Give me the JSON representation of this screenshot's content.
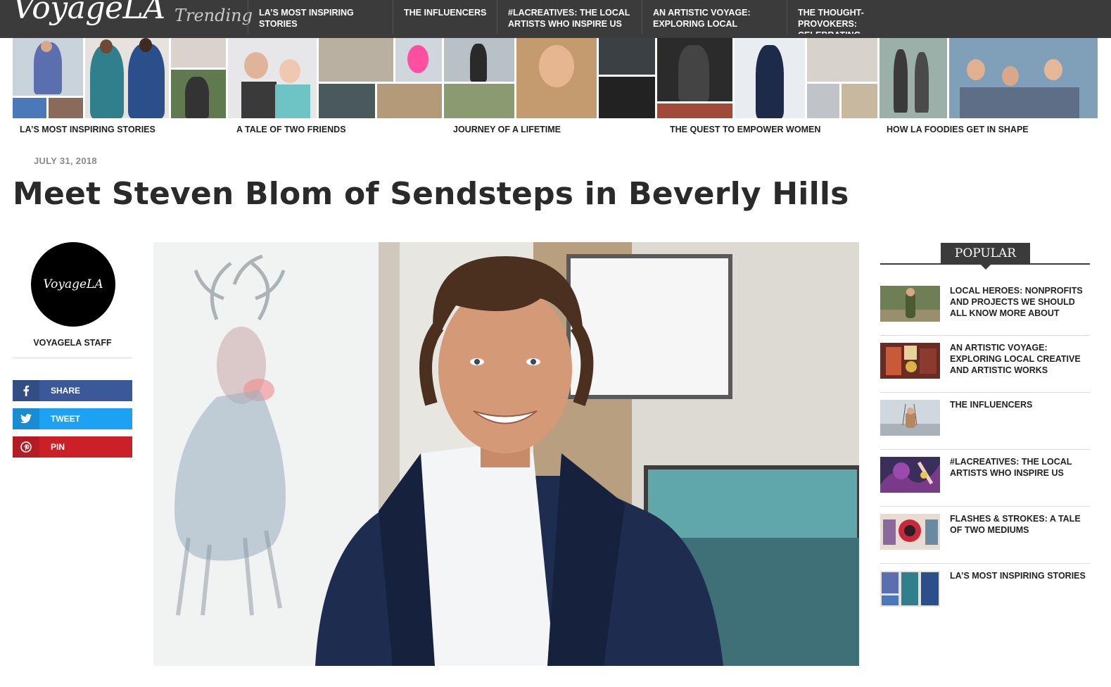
{
  "header": {
    "logo": "VoyageLA",
    "trending_label": "Trending",
    "trending_items": [
      "LA’s Most Inspiring Stories",
      "The Influencers",
      "#LACreatives: The Local Artists Who Inspire Us",
      "An Artistic Voyage: Exploring Local",
      "The Thought-Provokers: Celebrating"
    ]
  },
  "strip": {
    "labels": [
      "LA’s Most Inspiring Stories",
      "A Tale of Two Friends",
      "Journey of a Lifetime",
      "The Quest to Empower Women",
      "How LA Foodies Get in Shape"
    ]
  },
  "article": {
    "date": "July 31, 2018",
    "title": "Meet Steven Blom of Sendsteps in Beverly Hills"
  },
  "author": {
    "avatar_text": "VoyageLA",
    "name": "VoyageLA Staff"
  },
  "share": {
    "facebook": "Share",
    "twitter": "Tweet",
    "pinterest": "Pin"
  },
  "sidebar": {
    "title": "Popular",
    "items": [
      "Local Heroes: Nonprofits and Projects We Should All Know More About",
      "An Artistic Voyage: Exploring Local Creative and Artistic Works",
      "The Influencers",
      "#LACreatives: The Local Artists Who Inspire Us",
      "Flashes & Strokes: A Tale of Two Mediums",
      "LA’s Most Inspiring Stories"
    ]
  },
  "colors": {
    "topbar": "#3b3b3b",
    "facebook": "#3b5998",
    "twitter": "#1da1f2",
    "pinterest": "#cb2027"
  }
}
